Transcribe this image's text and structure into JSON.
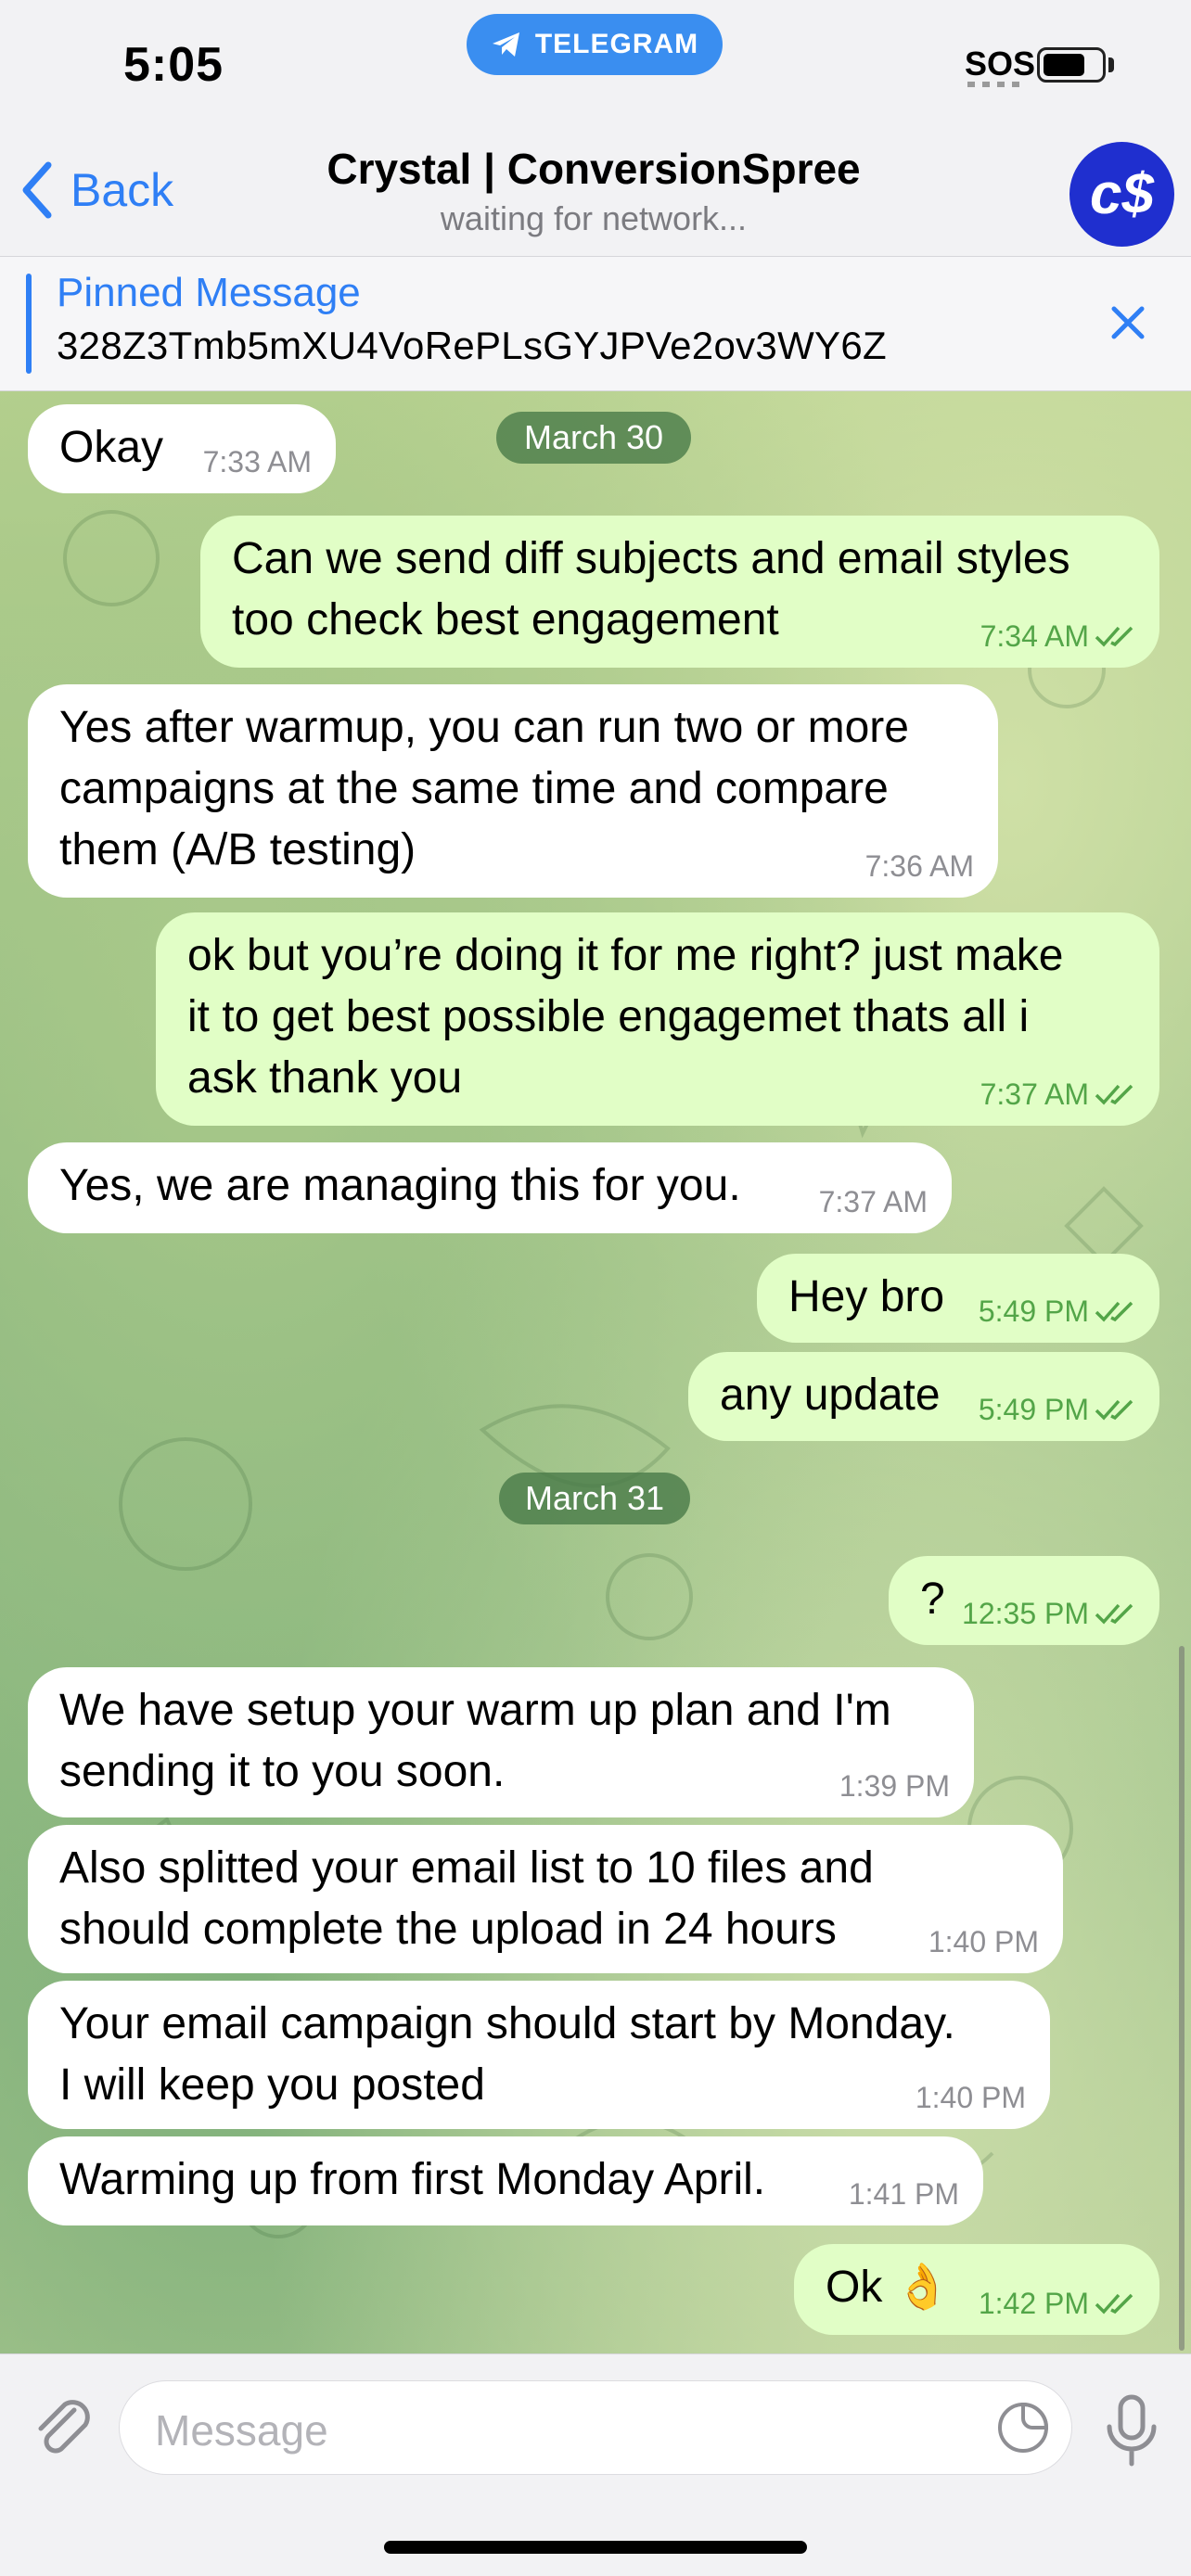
{
  "status_bar": {
    "time": "5:05",
    "app_pill": "TELEGRAM",
    "carrier": "SOS"
  },
  "header": {
    "back_label": "Back",
    "title": "Crystal | ConversionSpree",
    "subtitle": "waiting for network...",
    "avatar_text": "c$"
  },
  "pinned": {
    "label": "Pinned Message",
    "text": "328Z3Tmb5mXU4VoRePLsGYJPVe2ov3WY6Z"
  },
  "dates": [
    "March 30",
    "March 31"
  ],
  "messages": [
    {
      "dir": "in",
      "lines": [
        "Okay"
      ],
      "time": "7:33 AM"
    },
    {
      "dir": "out",
      "lines": [
        "Can we send diff subjects and email styles",
        "too check best engagement"
      ],
      "time": "7:34 AM"
    },
    {
      "dir": "in",
      "lines": [
        "Yes after warmup, you can run two or more",
        "campaigns at the same time and compare",
        "them (A/B testing)"
      ],
      "time": "7:36 AM"
    },
    {
      "dir": "out",
      "lines": [
        "ok but you’re doing it for me right? just make",
        "it to get best possible engagemet thats all i",
        "ask thank you"
      ],
      "time": "7:37 AM"
    },
    {
      "dir": "in",
      "lines": [
        "Yes, we are managing this for you."
      ],
      "time": "7:37 AM"
    },
    {
      "dir": "out",
      "lines": [
        "Hey bro"
      ],
      "time": "5:49 PM"
    },
    {
      "dir": "out",
      "lines": [
        "any update"
      ],
      "time": "5:49 PM"
    },
    {
      "dir": "out",
      "lines": [
        "?"
      ],
      "time": "12:35 PM"
    },
    {
      "dir": "in",
      "lines": [
        "We have setup your warm up plan and I'm",
        "sending it to you soon."
      ],
      "time": "1:39 PM"
    },
    {
      "dir": "in",
      "lines": [
        "Also splitted your email list to 10 files and",
        "should complete the upload in 24 hours"
      ],
      "time": "1:40 PM"
    },
    {
      "dir": "in",
      "lines": [
        "Your email campaign should start by Monday.",
        "I will keep you posted"
      ],
      "time": "1:40 PM"
    },
    {
      "dir": "in",
      "lines": [
        "Warming up from first Monday April."
      ],
      "time": "1:41 PM"
    },
    {
      "dir": "out",
      "lines": [
        "Ok 👌"
      ],
      "time": "1:42 PM"
    }
  ],
  "input": {
    "placeholder": "Message"
  },
  "colors": {
    "accent": "#2f7ff5",
    "outgoing_bubble": "#e1fec6",
    "incoming_bubble": "#ffffff",
    "read_ticks": "#53a548"
  }
}
